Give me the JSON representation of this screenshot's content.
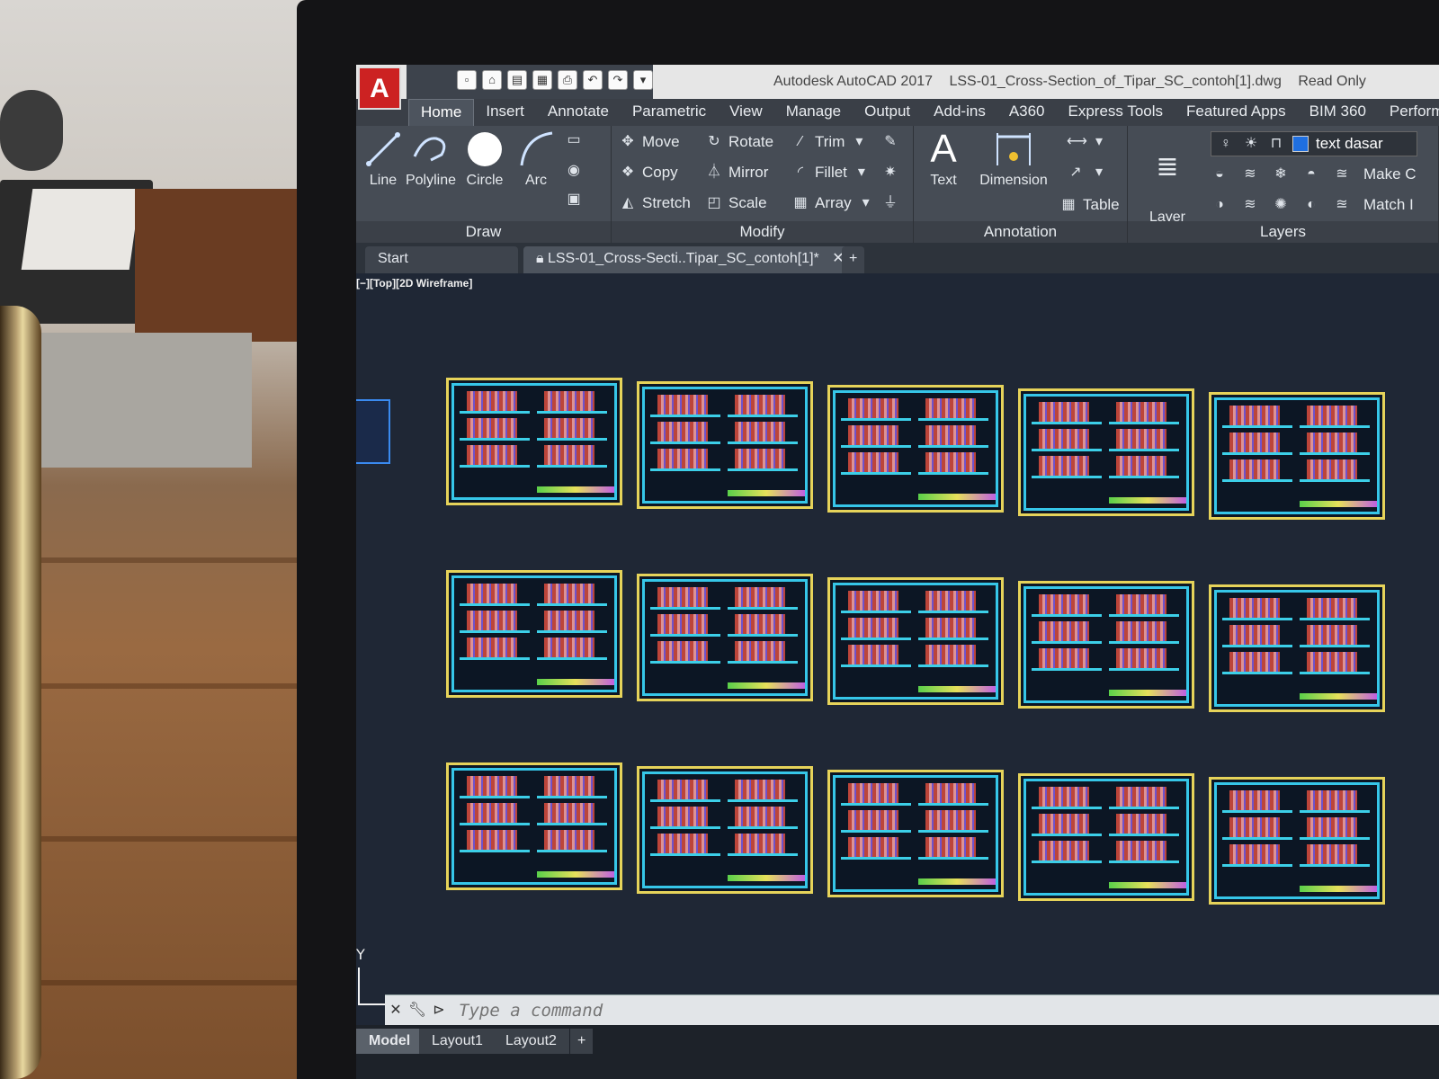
{
  "app": {
    "title": "Autodesk AutoCAD 2017",
    "file_name": "LSS-01_Cross-Section_of_Tipar_SC_contoh[1].dwg",
    "mode": "Read Only",
    "logo_letter": "A"
  },
  "ribbon_tabs": [
    "Home",
    "Insert",
    "Annotate",
    "Parametric",
    "View",
    "Manage",
    "Output",
    "Add-ins",
    "A360",
    "Express Tools",
    "Featured Apps",
    "BIM 360",
    "Performa"
  ],
  "draw_panel": {
    "title": "Draw",
    "tools": [
      "Line",
      "Polyline",
      "Circle",
      "Arc"
    ]
  },
  "modify_panel": {
    "title": "Modify",
    "tools": [
      "Move",
      "Rotate",
      "Trim",
      "Copy",
      "Mirror",
      "Fillet",
      "Stretch",
      "Scale",
      "Array"
    ]
  },
  "annotation_panel": {
    "title": "Annotation",
    "text": "Text",
    "dimension": "Dimension",
    "table": "Table"
  },
  "layers_panel": {
    "title": "Layers",
    "layer_properties": "Layer\nProperties",
    "current_layer": "text dasar",
    "make": "Make C",
    "match": "Match I"
  },
  "file_tabs": {
    "start": "Start",
    "active_file": "LSS-01_Cross-Secti..Tipar_SC_contoh[1]*"
  },
  "viewport_label": "[−][Top][2D Wireframe]",
  "ucs": {
    "y": "Y"
  },
  "command": {
    "placeholder": "Type a command"
  },
  "layout_tabs": [
    "Model",
    "Layout1",
    "Layout2"
  ],
  "drawing": {
    "sheet_rows": 3,
    "sheet_columns": 5
  },
  "colors": {
    "sheet_border": "#e6d35a",
    "sheet_frame": "#36c6e8",
    "canvas": "#1f2735",
    "logo": "#c22222"
  }
}
